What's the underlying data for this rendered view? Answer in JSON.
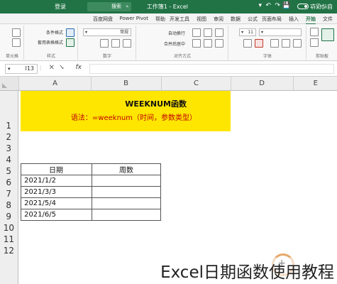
{
  "titlebar": {
    "autosave": "自动保存",
    "doc_title": "工作簿1 - Excel",
    "search_placeholder": "搜索",
    "login": "登录",
    "quick_access": [
      "💾",
      "↶",
      "↷",
      "▾"
    ]
  },
  "tabs": [
    "文件",
    "开始",
    "插入",
    "页面布局",
    "公式",
    "数据",
    "审阅",
    "视图",
    "开发工具",
    "帮助",
    "Power Pivot",
    "百度网盘"
  ],
  "active_tab": "开始",
  "ribbon": {
    "clipboard_label": "剪贴板",
    "font_label": "字体",
    "font_size": "11",
    "alignment_label": "对齐方式",
    "number_label": "数字",
    "number_format": "常规",
    "styles_label": "样式",
    "conditional_format": "条件格式",
    "format_as_table": "套用表格格式",
    "cell_styles": "单元格样式",
    "cells_label": "单元格",
    "wrap_text": "自动换行",
    "merge_center": "合并后居中"
  },
  "formula_bar": {
    "name_box": "I13",
    "fx": "fx",
    "cancel": "✕",
    "confirm": "✓"
  },
  "columns": [
    "A",
    "B",
    "C",
    "D",
    "E"
  ],
  "rows": [
    "1",
    "2",
    "3",
    "4",
    "5",
    "6",
    "7",
    "8",
    "9",
    "10",
    "11",
    "12"
  ],
  "title_block": {
    "title": "WEEKNUM函数",
    "syntax": "语法：=weeknum（时间，参数类型）"
  },
  "table": {
    "header": [
      "日期",
      "周数"
    ],
    "rows": [
      [
        "2021/1/2",
        ""
      ],
      [
        "2021/3/3",
        ""
      ],
      [
        "2021/5/4",
        ""
      ],
      [
        "2021/6/5",
        ""
      ]
    ]
  },
  "caption": "Excel日期函数使用教程",
  "colors": {
    "excel_green": "#217346",
    "title_fill": "#ffe600",
    "syntax_text": "#c00000"
  }
}
